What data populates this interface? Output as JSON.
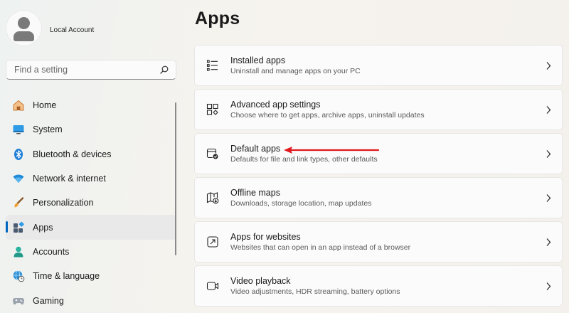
{
  "account": {
    "name": "Local Account"
  },
  "search": {
    "placeholder": "Find a setting"
  },
  "sidebar": {
    "items": [
      {
        "label": "Home",
        "icon": "home-icon"
      },
      {
        "label": "System",
        "icon": "monitor-icon"
      },
      {
        "label": "Bluetooth & devices",
        "icon": "bluetooth-icon"
      },
      {
        "label": "Network & internet",
        "icon": "wifi-icon"
      },
      {
        "label": "Personalization",
        "icon": "brush-icon"
      },
      {
        "label": "Apps",
        "icon": "apps-icon",
        "selected": true
      },
      {
        "label": "Accounts",
        "icon": "person-icon"
      },
      {
        "label": "Time & language",
        "icon": "globe-clock-icon"
      },
      {
        "label": "Gaming",
        "icon": "gamepad-icon"
      }
    ]
  },
  "main": {
    "title": "Apps",
    "cards": [
      {
        "title": "Installed apps",
        "subtitle": "Uninstall and manage apps on your PC",
        "icon": "list-icon"
      },
      {
        "title": "Advanced app settings",
        "subtitle": "Choose where to get apps, archive apps, uninstall updates",
        "icon": "app-settings-icon"
      },
      {
        "title": "Default apps",
        "subtitle": "Defaults for file and link types, other defaults",
        "icon": "default-apps-icon"
      },
      {
        "title": "Offline maps",
        "subtitle": "Downloads, storage location, map updates",
        "icon": "map-download-icon"
      },
      {
        "title": "Apps for websites",
        "subtitle": "Websites that can open in an app instead of a browser",
        "icon": "open-in-app-icon"
      },
      {
        "title": "Video playback",
        "subtitle": "Video adjustments, HDR streaming, battery options",
        "icon": "video-icon"
      }
    ]
  },
  "colors": {
    "accent": "#0067c0",
    "annotation_arrow": "#e0191f"
  }
}
